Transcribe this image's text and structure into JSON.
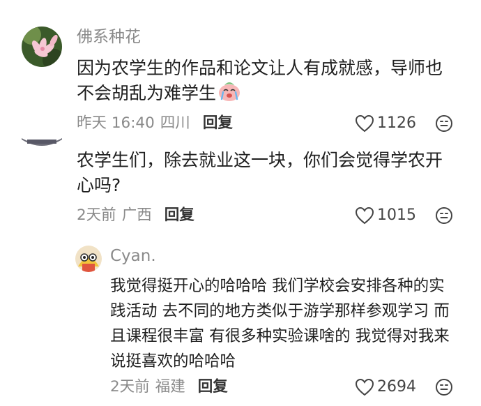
{
  "comments": [
    {
      "username": "佛系种花",
      "text": "因为农学生的作品和论文让人有成就感，导师也不会胡乱为难学生",
      "emoji": "crying-face-sticker",
      "time": "昨天 16:40",
      "location": "四川",
      "reply_label": "回复",
      "likes": "1126"
    },
    {
      "username": "",
      "text": "农学生们，除去就业这一块，你们会觉得学农开心吗?",
      "time": "2天前",
      "location": "广西",
      "reply_label": "回复",
      "likes": "1015"
    }
  ],
  "reply": {
    "username": "Cyan.",
    "text": "我觉得挺开心的哈哈哈 我们学校会安排各种的实践活动 去不同的地方类似于游学那样参观学习 而且课程很丰富 有很多种实验课啥的 我觉得对我来说挺喜欢的哈哈哈",
    "time": "2天前",
    "location": "福建",
    "reply_label": "回复",
    "likes": "2694"
  },
  "icons": {
    "like": "heart-outline-icon",
    "react": "emoji-face-icon"
  }
}
